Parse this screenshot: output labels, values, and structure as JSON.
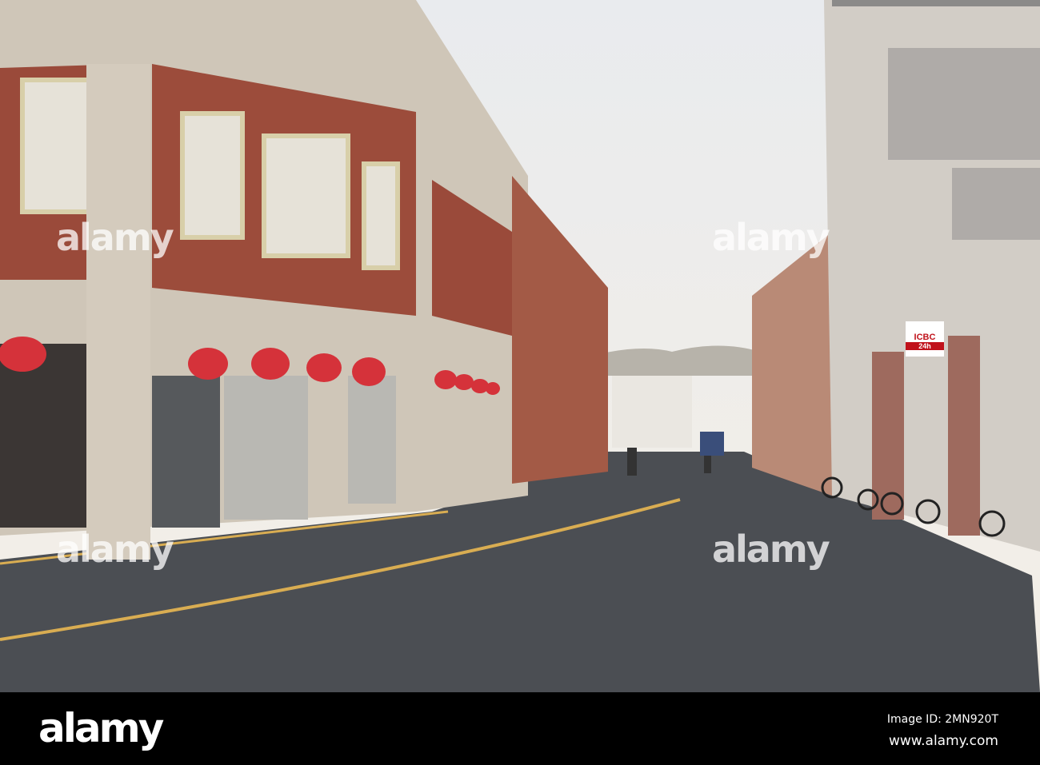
{
  "photo": {
    "description_colors": {
      "sky": "#efece6",
      "road": "#4a4d52",
      "brick": "#9c4a3a",
      "line": "#e0b14a",
      "lantern": "#d5323a"
    },
    "signs": {
      "bank": "ICBC",
      "bank_sub": "24h"
    },
    "watermarks": [
      "alamy",
      "alamy",
      "alamy",
      "alamy"
    ]
  },
  "footer": {
    "logo": "alamy",
    "image_id": "Image ID: 2MN920T",
    "url": "www.alamy.com"
  }
}
